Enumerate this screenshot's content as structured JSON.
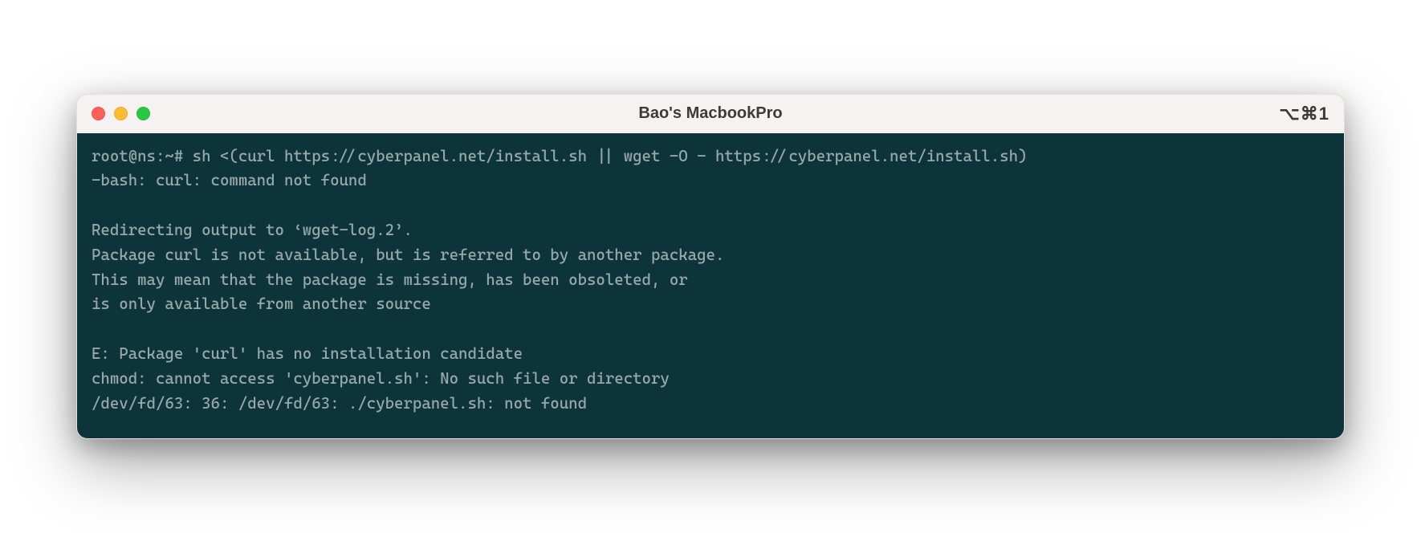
{
  "window": {
    "title": "Bao's MacbookPro",
    "shortcut": "⌥⌘1"
  },
  "terminal": {
    "lines": [
      "root@ns:~# sh <(curl https://cyberpanel.net/install.sh || wget -O - https://cyberpanel.net/install.sh)",
      "-bash: curl: command not found",
      "",
      "Redirecting output to ‘wget-log.2’.",
      "Package curl is not available, but is referred to by another package.",
      "This may mean that the package is missing, has been obsoleted, or",
      "is only available from another source",
      "",
      "E: Package 'curl' has no installation candidate",
      "chmod: cannot access 'cyberpanel.sh': No such file or directory",
      "/dev/fd/63: 36: /dev/fd/63: ./cyberpanel.sh: not found"
    ]
  }
}
